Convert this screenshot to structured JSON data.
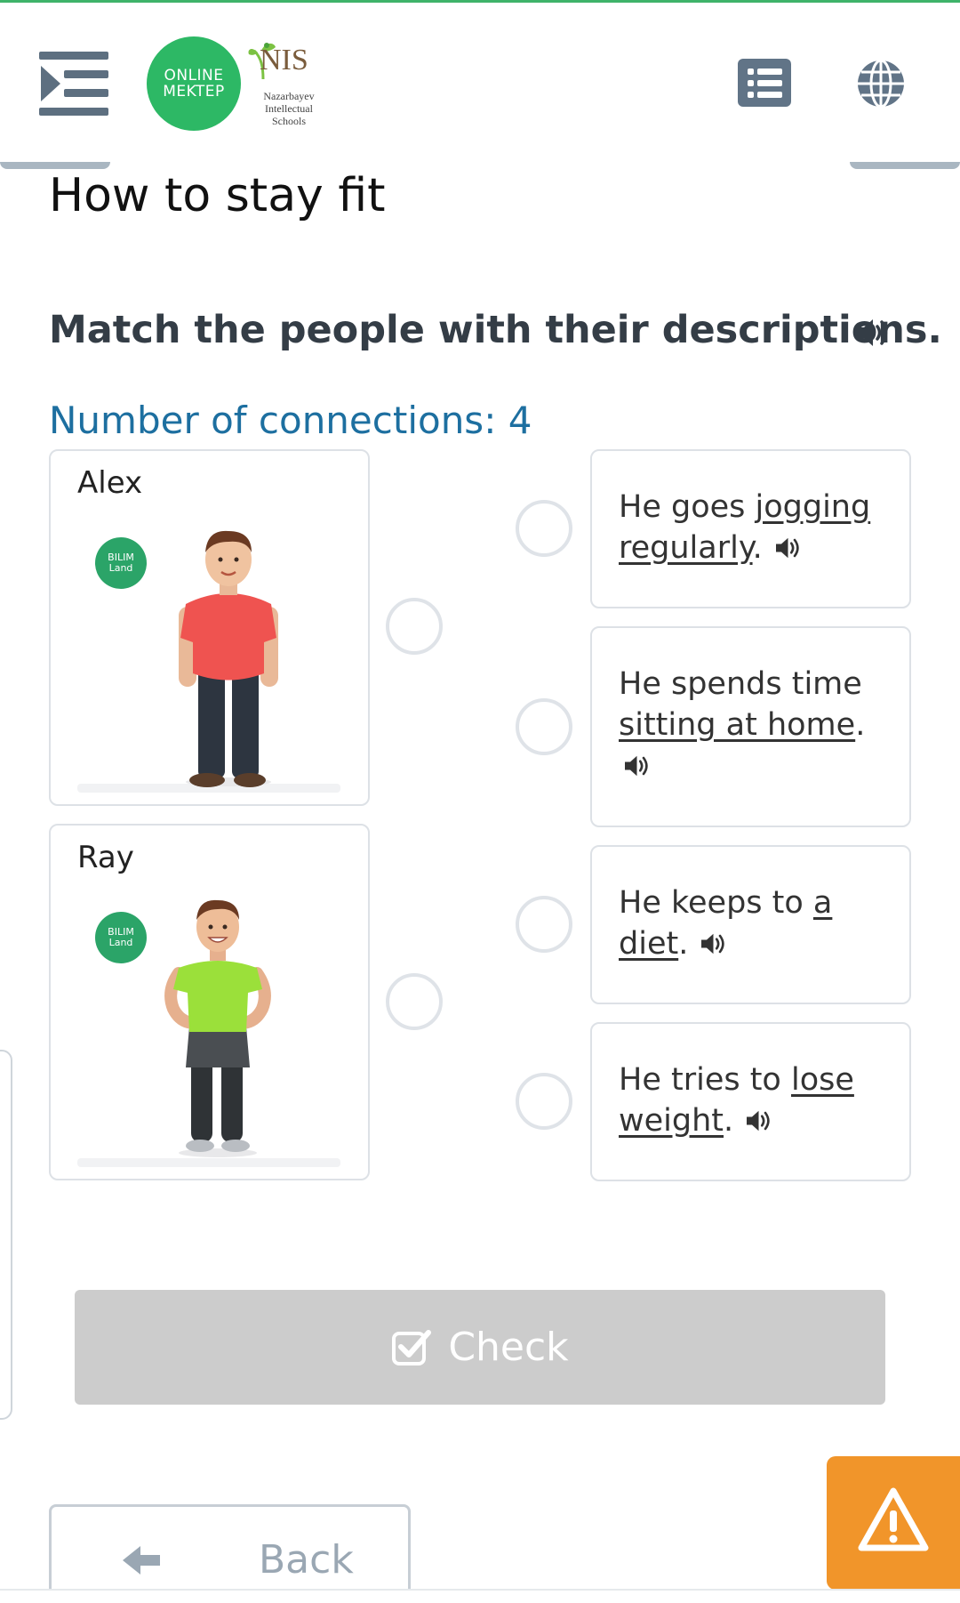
{
  "header": {
    "logo_online": "ONLINE",
    "logo_mektep": "MEKTEP",
    "logo_nis": "NIS",
    "logo_nis_sub": "Nazarbayev Intellectual Schools"
  },
  "lesson": {
    "title": "How to stay fit",
    "instruction": "Match the people with their descriptions.",
    "connections_label": "Number of connections: 4"
  },
  "people": [
    {
      "name": "Alex",
      "watermark_line1": "BILIM",
      "watermark_line2": "Land",
      "shirt_color": "#ef5350",
      "pants_color": "#2d3540"
    },
    {
      "name": "Ray",
      "watermark_line1": "BILIM",
      "watermark_line2": "Land",
      "shirt_color": "#9be03a",
      "pants_color": "#2f3336"
    }
  ],
  "descriptions": [
    {
      "pre": "He goes ",
      "link": "jogging regularly",
      "post": "."
    },
    {
      "pre": "He spends time ",
      "link": "sitting at home",
      "post": "."
    },
    {
      "pre": "He keeps to ",
      "link": "a diet",
      "post": "."
    },
    {
      "pre": "He tries to ",
      "link": "lose weight",
      "post": "."
    }
  ],
  "actions": {
    "check_label": "Check",
    "back_label": "Back"
  },
  "colors": {
    "accent_green": "#2db865",
    "link_blue": "#1d6fa0",
    "warning_orange": "#f1952a",
    "disabled_gray": "#cccccc"
  },
  "icons": [
    "menu-icon",
    "list-icon",
    "globe-icon",
    "speaker-icon",
    "checkbox-icon",
    "arrow-left-icon",
    "warning-icon"
  ]
}
